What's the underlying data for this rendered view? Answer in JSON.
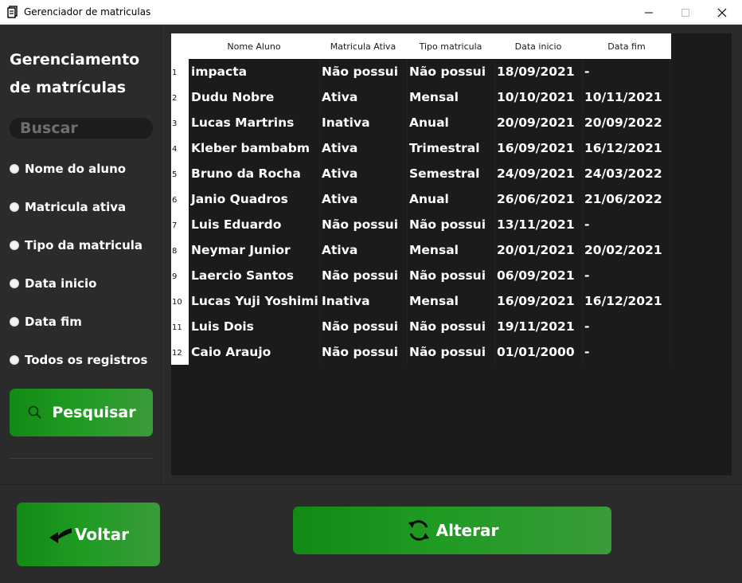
{
  "window": {
    "title": "Gerenciador de matriculas"
  },
  "sidebar": {
    "title_line1": "Gerenciamento",
    "title_line2": "de matrículas",
    "search_placeholder": "Buscar",
    "radios": [
      "Nome do aluno",
      "Matricula ativa",
      "Tipo da matricula",
      "Data inicio",
      "Data fim",
      "Todos os registros"
    ],
    "search_button": "Pesquisar"
  },
  "actions": {
    "back_label": "Voltar",
    "alter_label": "Alterar"
  },
  "colors": {
    "accent_green": "#1f9b22",
    "background": "#2b2b2b",
    "table_bg": "#1b1b1b"
  },
  "table": {
    "columns": [
      "Nome Aluno",
      "Matricula Ativa",
      "Tipo matricula",
      "Data inicio",
      "Data fim"
    ],
    "row_numbers": [
      "1",
      "2",
      "3",
      "4",
      "5",
      "6",
      "7",
      "8",
      "9",
      "10",
      "11",
      "12"
    ],
    "rows": [
      [
        "impacta",
        "Não possui",
        "Não possui",
        "18/09/2021",
        "-"
      ],
      [
        "Dudu Nobre",
        "Ativa",
        "Mensal",
        "10/10/2021",
        "10/11/2021"
      ],
      [
        "Lucas Martrins",
        "Inativa",
        "Anual",
        "20/09/2021",
        "20/09/2022"
      ],
      [
        "Kleber bambabm",
        "Ativa",
        "Trimestral",
        "16/09/2021",
        "16/12/2021"
      ],
      [
        "Bruno da Rocha",
        "Ativa",
        "Semestral",
        "24/09/2021",
        "24/03/2022"
      ],
      [
        "Janio Quadros",
        "Ativa",
        "Anual",
        "26/06/2021",
        "21/06/2022"
      ],
      [
        "Luis Eduardo",
        "Não possui",
        "Não possui",
        "13/11/2021",
        "-"
      ],
      [
        "Neymar Junior",
        "Ativa",
        "Mensal",
        "20/01/2021",
        "20/02/2021"
      ],
      [
        "Laercio Santos",
        "Não possui",
        "Não possui",
        "06/09/2021",
        "-"
      ],
      [
        "Lucas Yuji Yoshimine",
        "Inativa",
        "Mensal",
        "16/09/2021",
        "16/12/2021"
      ],
      [
        "Luis Dois",
        "Não possui",
        "Não possui",
        "19/11/2021",
        "-"
      ],
      [
        "Caio Araujo",
        "Não possui",
        "Não possui",
        "01/01/2000",
        "-"
      ]
    ]
  }
}
